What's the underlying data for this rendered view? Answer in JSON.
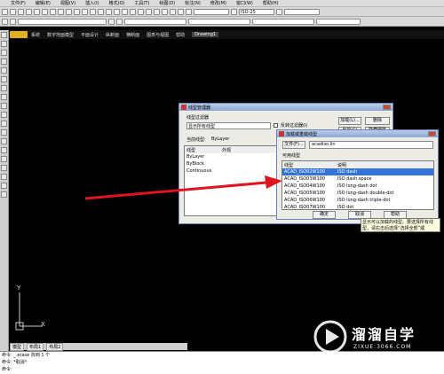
{
  "menubar": [
    "文件(F)",
    "编辑(E)",
    "视图(V)",
    "插入(I)",
    "格式(O)",
    "工具(T)",
    "绘图(D)",
    "标注(N)",
    "修改(M)",
    "窗口(W)",
    "帮助(H)"
  ],
  "cad_menu": {
    "items": [
      "系统",
      "数字地面模型",
      "平面设计",
      "纵断面",
      "横断面",
      "图表与视图",
      "帮助"
    ],
    "tab": "Drawing1"
  },
  "toolbar3_dropdown": "ISO-25",
  "linetype_manager": {
    "title": "线型管理器",
    "filter_label": "线型过滤器",
    "filter_value": "显示所有线型",
    "invert_label": "反转过滤器(I)",
    "load_button": "加载(L)...",
    "delete_button": "删除",
    "current_button": "当前(C)",
    "details_button": "隐藏细节(D)",
    "current_label": "当前线型:",
    "current_value": "ByLayer",
    "col_linetype": "线型",
    "col_appearance": "外观",
    "rows": [
      "ByLayer",
      "ByBlock",
      "Continuous"
    ]
  },
  "load_dialog": {
    "title": "加载或重载线型",
    "file_button": "文件(F)...",
    "file_value": "acadiso.lin",
    "available_label": "可用线型",
    "col_linetype": "线型",
    "col_desc": "说明",
    "rows": [
      {
        "name": "ACAD_ISO02W100",
        "desc": "ISO dash"
      },
      {
        "name": "ACAD_ISO03W100",
        "desc": "ISO dash space"
      },
      {
        "name": "ACAD_ISO04W100",
        "desc": "ISO long-dash dot"
      },
      {
        "name": "ACAD_ISO05W100",
        "desc": "ISO long-dash double-dot"
      },
      {
        "name": "ACAD_ISO06W100",
        "desc": "ISO long-dash triple-dot"
      },
      {
        "name": "ACAD_ISO07W100",
        "desc": "ISO dot"
      }
    ],
    "ok_button": "确定",
    "cancel_button": "取消",
    "help_button": "帮助"
  },
  "tooltip": "显示可以加载的线型。要选择所有线型，请右击后选择“选择全部”或",
  "ucs": {
    "y": "Y",
    "x": "X"
  },
  "layout_tabs": [
    "模型",
    "布局1",
    "布局2"
  ],
  "command_lines": [
    "命令: _.erase 找到 1 个",
    "命令: *取消*",
    "命令:"
  ],
  "watermark": {
    "title": "溜溜自学",
    "url": "ZIXUE.3066.COM"
  },
  "colors": {
    "arrow": "#e0141e",
    "selection": "#3374d6",
    "titlebar": "#8fa8d4"
  }
}
